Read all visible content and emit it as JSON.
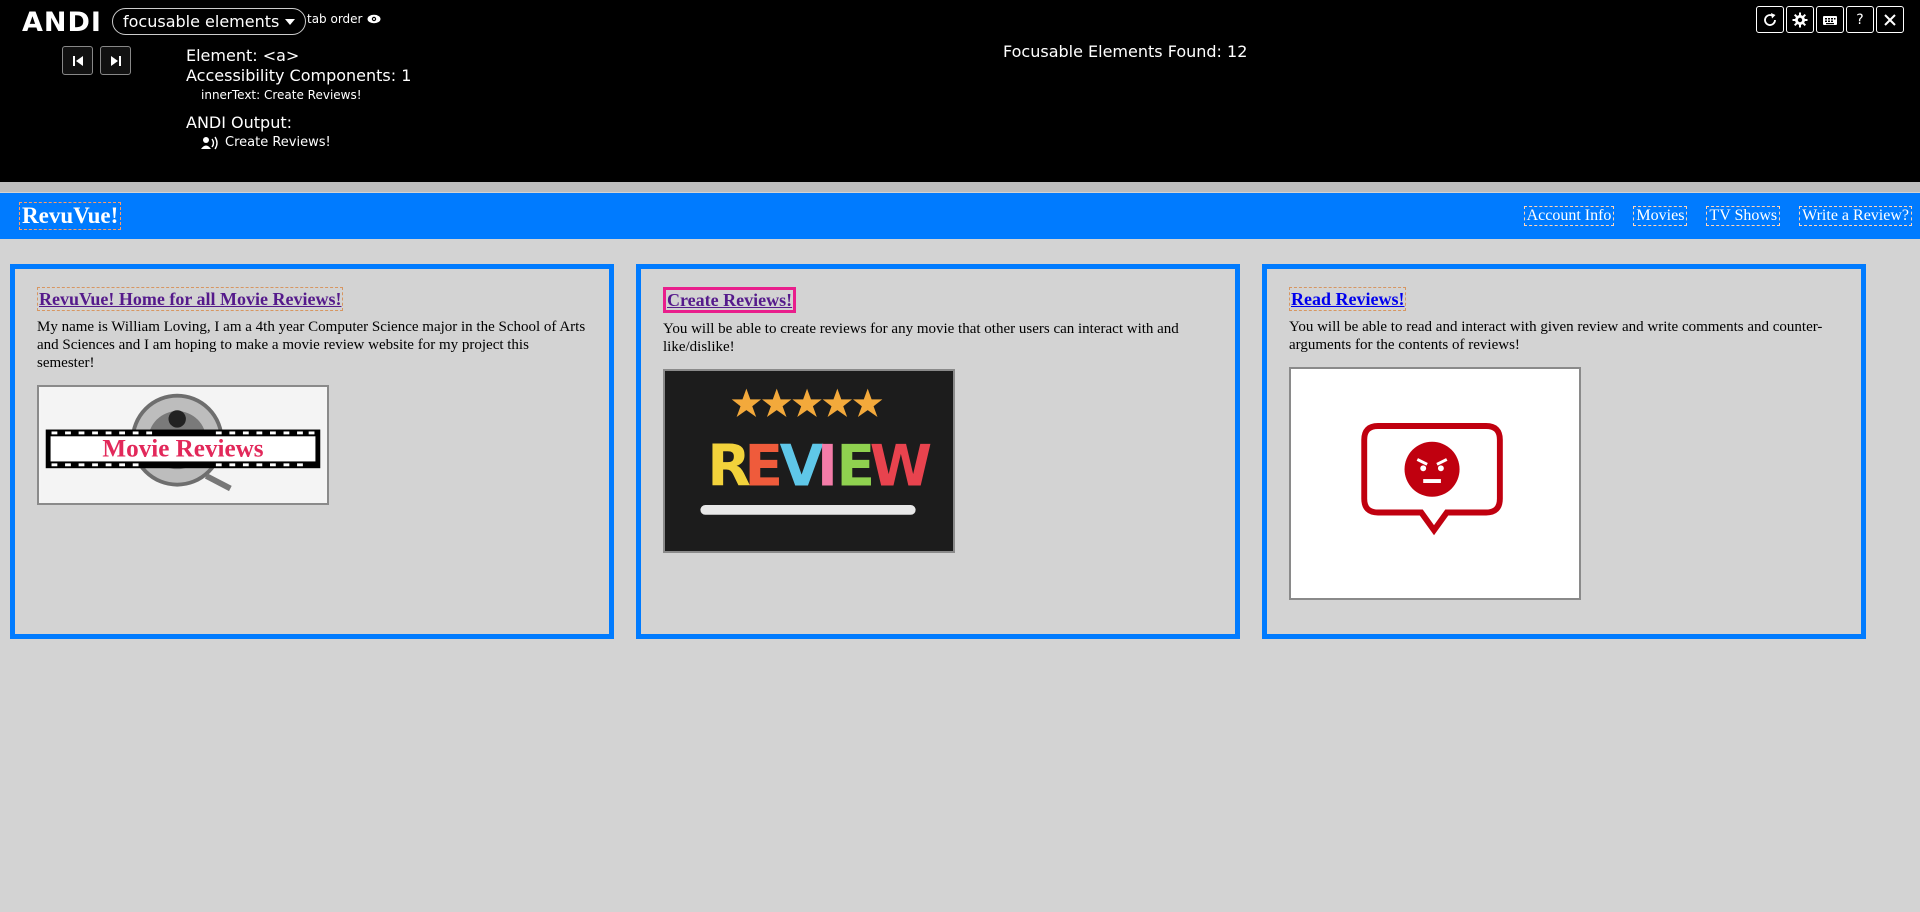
{
  "andi": {
    "logo": "ANDI",
    "module": "focusable elements",
    "tab_order": "tab order",
    "element_line": "Element: <a>",
    "components_line": "Accessibility Components: 1",
    "inner_text_line": "innerText: Create Reviews!",
    "output_label": "ANDI Output:",
    "output_text": "Create Reviews!",
    "found_count": "Focusable Elements Found: 12",
    "controls": [
      "refresh-icon",
      "gear-icon",
      "keyboard-icon",
      "help-icon",
      "close-icon"
    ],
    "help_glyph": "?"
  },
  "site": {
    "brand": "RevuVue!",
    "nav": [
      "Account Info",
      "Movies",
      "TV Shows",
      "Write a Review?"
    ]
  },
  "cards": [
    {
      "title": "RevuVue! Home for all Movie Reviews!",
      "text": "My name is William Loving, I am a 4th year Computer Science major in the School of Arts and Sciences and I am hoping to make a movie review website for my project this semester!",
      "image_text": "Movie Reviews"
    },
    {
      "title": "Create Reviews!",
      "text": "You will be able to create reviews for any movie that other users can interact with and like/dislike!",
      "image_text": "REVIEW"
    },
    {
      "title": "Read Reviews!",
      "text": "You will be able to read and interact with given review and write comments and counter-arguments for the contents of reviews!"
    }
  ],
  "colors": {
    "andi_bg": "#000000",
    "header_blue": "#007bff",
    "page_bg": "#d3d3d3",
    "focus_pink": "#e91e8c",
    "angry_red": "#c0000f"
  }
}
